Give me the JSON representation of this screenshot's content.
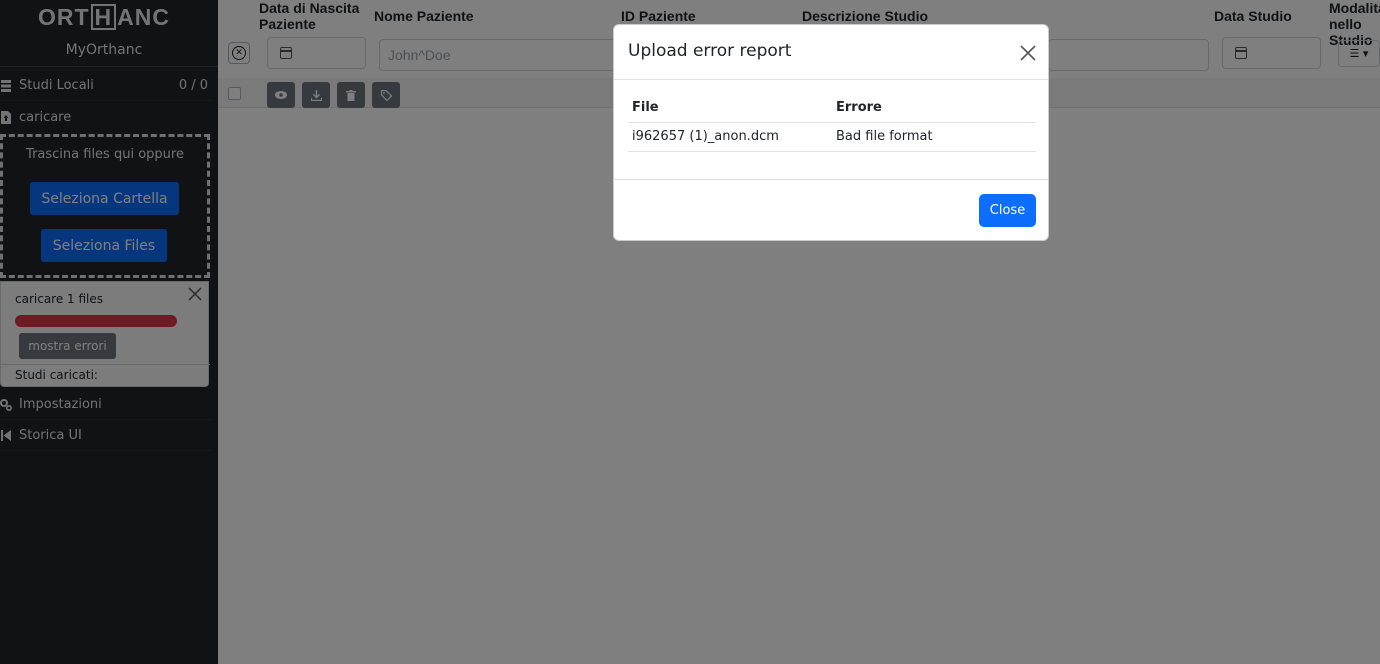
{
  "sidebar": {
    "logo_left": "ORT",
    "logo_h": "H",
    "logo_right": "ANC",
    "instance_name": "MyOrthanc",
    "local_studies_label": "Studi Locali",
    "local_studies_count": "0 / 0",
    "upload_label": "caricare",
    "dropzone_text": "Trascina files qui oppure",
    "select_folder_label": "Seleziona Cartella",
    "select_files_label": "Seleziona Files",
    "upload_card": {
      "title": "caricare 1 files",
      "progress": 1.0,
      "progress_color": "#dc3545",
      "show_errors_label": "mostra errori",
      "loaded_studies_label": "Studi caricati:"
    },
    "settings_label": "Impostazioni",
    "legacy_ui_label": "Storica UI"
  },
  "table": {
    "columns": {
      "birth_date_line1": "Data di Nascita",
      "birth_date_line2": "Paziente",
      "patient_name": "Nome Paziente",
      "patient_id": "ID Paziente",
      "study_description": "Descrizione Studio",
      "study_date": "Data Studio",
      "modality_line1": "Modalità",
      "modality_line2": "nello Studio"
    },
    "filters": {
      "patient_name_placeholder": "John^Doe"
    }
  },
  "modal": {
    "title": "Upload error report",
    "headers": [
      "File",
      "Errore"
    ],
    "rows": [
      {
        "file": "i962657 (1)_anon.dcm",
        "error": "Bad file format"
      }
    ],
    "close_label": "Close"
  },
  "colors": {
    "sidebar_bg": "#212529",
    "primary": "#0d6efd",
    "danger": "#dc3545",
    "secondary": "#6c757d"
  }
}
